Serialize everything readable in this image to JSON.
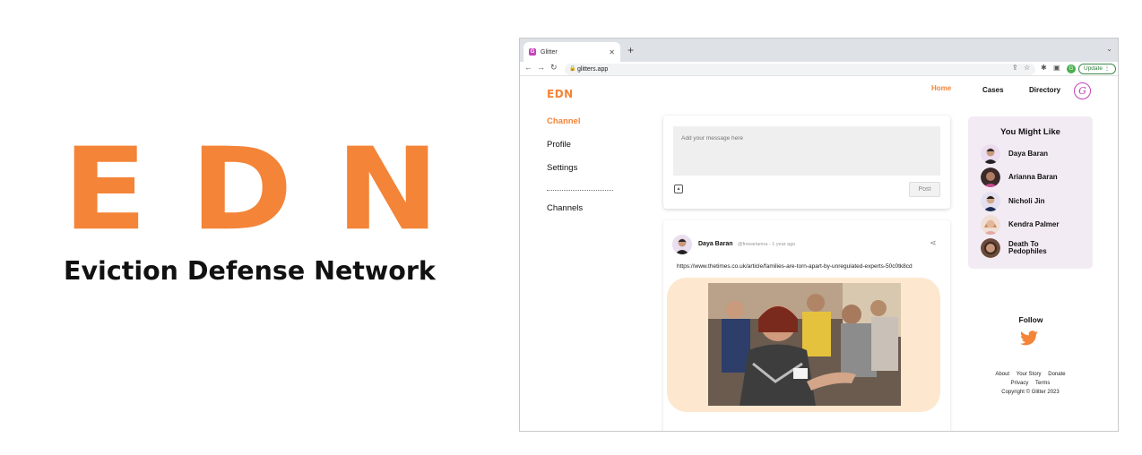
{
  "brand": {
    "logo_letters": [
      "E",
      "D",
      "N"
    ],
    "tagline": "Eviction Defense Network",
    "accent_color": "#f38438"
  },
  "browser": {
    "tab_title": "Glitter",
    "favicon_letter": "G",
    "url": "glitters.app",
    "profile_initial": "G",
    "update_label": "Update"
  },
  "site": {
    "logo": "EDN",
    "topnav": [
      "Home",
      "Cases",
      "Directory"
    ],
    "glitter_logo": "G",
    "sidebar": [
      "Channel",
      "Profile",
      "Settings",
      "Channels"
    ]
  },
  "composer": {
    "placeholder": "Add your message here",
    "post_label": "Post"
  },
  "feed": {
    "author": "Daya Baran",
    "handle_time": "@freearianna - 1 year ago",
    "url": "https://www.thetimes.co.uk/article/families-are-torn-apart-by-unregulated-experts-50c0tk8cd"
  },
  "suggestions": {
    "title": "You Might Like",
    "people": [
      "Daya Baran",
      "Arianna Baran",
      "Nicholi Jin",
      "Kendra Palmer",
      "Death To Pedophiles"
    ]
  },
  "follow": {
    "label": "Follow",
    "icon": "twitter-bird-icon"
  },
  "footer": {
    "row1": [
      "About",
      "Your Story",
      "Donate"
    ],
    "row2": [
      "Privacy",
      "Terms"
    ],
    "copyright": "Copyright © Glitter 2023"
  }
}
